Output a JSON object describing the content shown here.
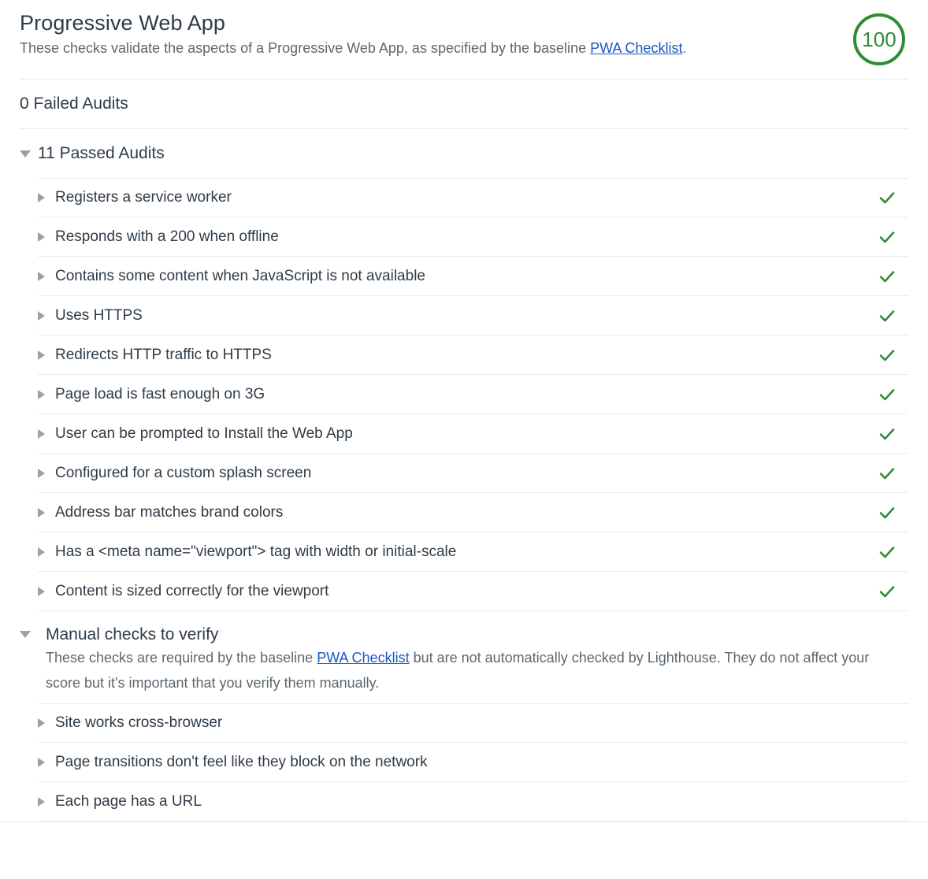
{
  "category": {
    "title": "Progressive Web App",
    "description_prefix": "These checks validate the aspects of a Progressive Web App, as specified by the baseline ",
    "description_link": "PWA Checklist",
    "description_suffix": ".",
    "score": "100",
    "score_color": "#2e8b37"
  },
  "failed_section": {
    "title": "0 Failed Audits",
    "expanded": false
  },
  "passed_section": {
    "title": "11 Passed Audits",
    "expanded": true,
    "toggle_icon": "triangle-down-icon",
    "audits": [
      {
        "label": "Registers a service worker",
        "status_icon": "check-icon"
      },
      {
        "label": "Responds with a 200 when offline",
        "status_icon": "check-icon"
      },
      {
        "label": "Contains some content when JavaScript is not available",
        "status_icon": "check-icon"
      },
      {
        "label": "Uses HTTPS",
        "status_icon": "check-icon"
      },
      {
        "label": "Redirects HTTP traffic to HTTPS",
        "status_icon": "check-icon"
      },
      {
        "label": "Page load is fast enough on 3G",
        "status_icon": "check-icon"
      },
      {
        "label": "User can be prompted to Install the Web App",
        "status_icon": "check-icon"
      },
      {
        "label": "Configured for a custom splash screen",
        "status_icon": "check-icon"
      },
      {
        "label": "Address bar matches brand colors",
        "status_icon": "check-icon"
      },
      {
        "label": "Has a <meta name=\"viewport\"> tag with width or initial-scale",
        "status_icon": "check-icon"
      },
      {
        "label": "Content is sized correctly for the viewport",
        "status_icon": "check-icon"
      }
    ]
  },
  "manual_section": {
    "title": "Manual checks to verify",
    "expanded": true,
    "toggle_icon": "triangle-down-icon",
    "description_prefix": "These checks are required by the baseline ",
    "description_link": "PWA Checklist",
    "description_suffix": " but are not automatically checked by Lighthouse. They do not affect your score but it's important that you verify them manually.",
    "audits": [
      {
        "label": "Site works cross-browser"
      },
      {
        "label": "Page transitions don't feel like they block on the network"
      },
      {
        "label": "Each page has a URL"
      }
    ]
  },
  "colors": {
    "pass_green": "#2e8b37",
    "link_blue": "#1a57c4",
    "text_dark": "#2e3b47",
    "text_muted": "#5b6770",
    "divider": "#e9eaec"
  }
}
